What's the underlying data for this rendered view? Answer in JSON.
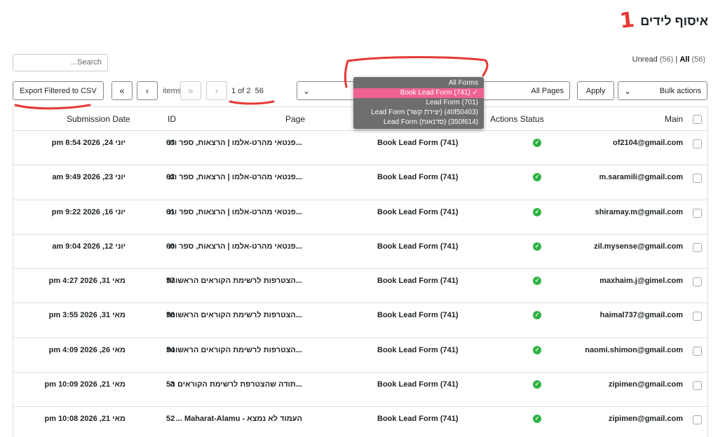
{
  "header": {
    "title": "איסוף לידים",
    "annotation_number": "1"
  },
  "filters": {
    "unread_label": "Unread",
    "unread_count": "(56)",
    "separator": "|",
    "all_label": "All",
    "all_count": "(56)"
  },
  "search": {
    "placeholder": "...Search"
  },
  "toolbar": {
    "export_label": "Export Filtered to CSV",
    "first_page": "«",
    "prev_page": "‹",
    "next_page": "›",
    "last_page": "»",
    "items_label": "items",
    "page_info": "1 of 2",
    "items_count": "56",
    "pages_select": "All Pages",
    "apply_label": "Apply",
    "bulk_actions": "Bulk actions"
  },
  "forms_dropdown": {
    "options": [
      "All Forms",
      "Book Lead Form (741) ✓",
      "Lead Form (701)",
      "Lead Form (יצירת קשר) (40f50403)",
      "Lead Form (סדנאות) (350f614)"
    ],
    "selected_index": 1
  },
  "table": {
    "headers": {
      "main": "Main",
      "actions_status": "Actions Status",
      "form": "",
      "page": "Page",
      "id": "ID",
      "date": "Submission Date"
    },
    "rows": [
      {
        "email": "of2104@gmail.com",
        "form": "Book Lead Form (741)",
        "page": "...פנטאי מהרט-אלמו | הרצאות, ספר ומ",
        "id": "63",
        "date": "יוני 24, 2026 8:54 pm"
      },
      {
        "email": "m.saramili@gmail.com",
        "form": "Book Lead Form (741)",
        "page": "...פנטאי מהרט-אלמו | הרצאות, ספר ומ",
        "id": "62",
        "date": "יוני 23, 2026 9:49 am"
      },
      {
        "email": "shiramay.m@gmail.com",
        "form": "Book Lead Form (741)",
        "page": "...פנטאי מהרט-אלמו | הרצאות, ספר ומ",
        "id": "61",
        "date": "יוני 16, 2026 9:22 pm"
      },
      {
        "email": "zil.mysense@gmail.com",
        "form": "Book Lead Form (741)",
        "page": "...פנטאי מהרט-אלמו | הרצאות, ספר ומ",
        "id": "60",
        "date": "יוני 12, 2026 9:04 am"
      },
      {
        "email": "maxhaim.j@gimel.com",
        "form": "Book Lead Form (741)",
        "page": "...הצטרפות לרשימת הקוראים הראשונה",
        "id": "57",
        "date": "מאי 31, 2026 4:27 pm"
      },
      {
        "email": "haimal737@gmail.com",
        "form": "Book Lead Form (741)",
        "page": "...הצטרפות לרשימת הקוראים הראשונה",
        "id": "56",
        "date": "מאי 31, 2026 3:55 pm"
      },
      {
        "email": "naomi.shimon@gmail.com",
        "form": "Book Lead Form (741)",
        "page": "...הצטרפות לרשימת הקוראים הראשונה",
        "id": "54",
        "date": "מאי 26, 2026 4:09 pm"
      },
      {
        "email": "zipimen@gmail.com",
        "form": "Book Lead Form (741)",
        "page": "...תודה שהצטרפת לרשימת הקוראים ה",
        "id": "53",
        "date": "מאי 21, 2026 10:09 pm"
      },
      {
        "email": "zipimen@gmail.com",
        "form": "Book Lead Form (741)",
        "page": "העמוד לא נמצא - Maharat-Alamu ...",
        "id": "52",
        "date": "מאי 21, 2026 10:08 pm"
      }
    ]
  },
  "colors": {
    "accent_pink": "#f06292",
    "annotation_red": "#e53935",
    "status_green": "#2fb344"
  }
}
